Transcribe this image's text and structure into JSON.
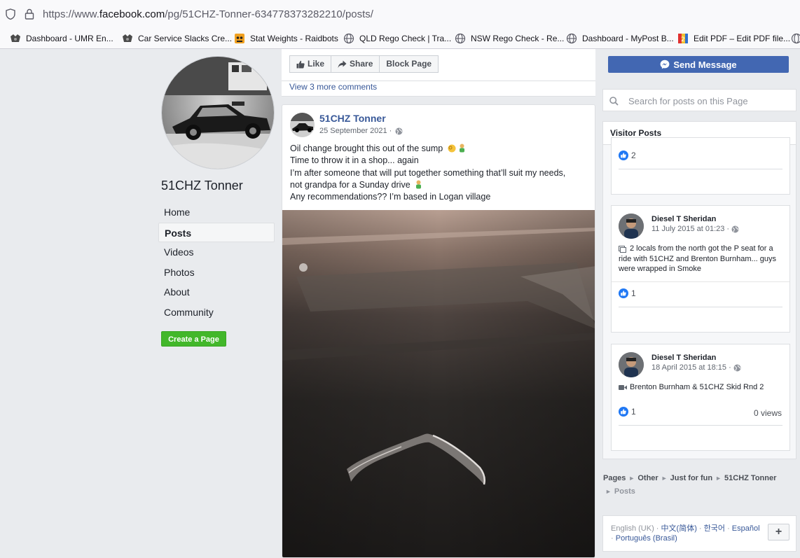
{
  "browser": {
    "url_prefix": "https://www.",
    "url_domain": "facebook.com",
    "url_path": "/pg/51CHZ-Tonner-634778373282210/posts/",
    "bookmarks": [
      {
        "label": "Dashboard - UMR En...",
        "icon": "umr-icon"
      },
      {
        "label": "Car Service Slacks Cre...",
        "icon": "car-service-icon"
      },
      {
        "label": "Stat Weights - Raidbots",
        "icon": "raidbots-icon"
      },
      {
        "label": "QLD Rego Check | Tra...",
        "icon": "globe-icon"
      },
      {
        "label": "NSW Rego Check - Re...",
        "icon": "globe-icon"
      },
      {
        "label": "Dashboard - MyPost B...",
        "icon": "globe-icon"
      },
      {
        "label": "Edit PDF – Edit PDF file...",
        "icon": "pdf-icon"
      }
    ]
  },
  "page": {
    "name": "51CHZ Tonner",
    "nav": [
      "Home",
      "Posts",
      "Videos",
      "Photos",
      "About",
      "Community"
    ],
    "active_nav": "Posts",
    "create_page_label": "Create a Page"
  },
  "actions": {
    "like": "Like",
    "share": "Share",
    "block": "Block Page",
    "send_message": "Send Message"
  },
  "comments_link": "View 3 more comments",
  "post": {
    "author": "51CHZ Tonner",
    "date": "25 September 2021 ·",
    "lines": [
      "Oil change brought this out of the sump",
      "Time to throw it in a shop... again",
      "I’m after someone that will put together something that’ll suit my needs,",
      "not grandpa for a Sunday drive",
      "Any recommendations?? I’m based in Logan village"
    ]
  },
  "search": {
    "placeholder": "Search for posts on this Page",
    "value": ""
  },
  "visitor_posts": {
    "title": "Visitor Posts",
    "items": [
      {
        "likes": "2"
      },
      {
        "author": "Diesel T Sheridan",
        "date": "11 July 2015 at 01:23 ·",
        "text": "2 locals from the north got the P seat for a ride with 51CHZ and Brenton Burnham... guys were wrapped in Smoke",
        "likes": "1"
      },
      {
        "author": "Diesel T Sheridan",
        "date": "18 April 2015 at 18:15 ·",
        "text": "Brenton Burnham & 51CHZ Skid Rnd 2",
        "likes": "1",
        "views": "0 views"
      }
    ]
  },
  "breadcrumbs": {
    "items": [
      "Pages",
      "Other",
      "Just for fun",
      "51CHZ Tonner"
    ],
    "last": "Posts"
  },
  "languages": {
    "current": "English (UK)",
    "others": [
      "中文(简体)",
      "한국어",
      "Español",
      "Português (Brasil)"
    ]
  },
  "colors": {
    "facebook_blue": "#4267b2",
    "link_blue": "#385898",
    "green": "#42b72a",
    "background": "#e9ebee"
  }
}
